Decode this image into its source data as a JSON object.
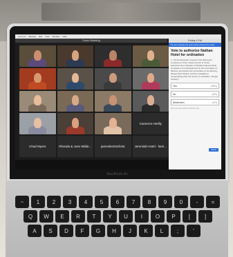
{
  "zoom": {
    "window_title": "Zoom Meeting",
    "menu": [
      "zoom.us",
      "Meeting",
      "Edit",
      "View",
      "Window",
      "Help"
    ],
    "participants": [
      {
        "name": "",
        "video": true,
        "skin": "#c98f6e",
        "shirt": "#5b4a7a",
        "bg": "#5a4d3a"
      },
      {
        "name": "",
        "video": true,
        "skin": "#d7a480",
        "shirt": "#2c3a52",
        "bg": "#4a3a2e"
      },
      {
        "name": "",
        "video": true,
        "skin": "#b98467",
        "shirt": "#8a2a2a",
        "bg": "#2e2e2e"
      },
      {
        "name": "",
        "video": true,
        "skin": "#e0b08f",
        "shirt": "#4b5b3a",
        "bg": "#6b5a44"
      },
      {
        "name": "",
        "video": true,
        "skin": "#d9996f",
        "shirt": "#c04a22",
        "bg": "#a33b1f"
      },
      {
        "name": "",
        "video": true,
        "skin": "#e3b796",
        "shirt": "#2e4a6a",
        "bg": "#5a5148"
      },
      {
        "name": "",
        "video": true,
        "skin": "#cc9a7c",
        "shirt": "#3a3a3a",
        "bg": "#4a4a4a"
      },
      {
        "name": "",
        "video": true,
        "skin": "#e2a88a",
        "shirt": "#b03a5a",
        "bg": "#6b6b6b"
      },
      {
        "name": "",
        "video": true,
        "skin": "#e8bd9c",
        "shirt": "#7a6a5a",
        "bg": "#9a8a78"
      },
      {
        "name": "",
        "video": true,
        "skin": "#d8a988",
        "shirt": "#5a5a7a",
        "bg": "#7a6a55"
      },
      {
        "name": "",
        "video": true,
        "skin": "#c99475",
        "shirt": "#3a4a5a",
        "bg": "#8a7a66"
      },
      {
        "name": "",
        "video": true,
        "skin": "#dcae90",
        "shirt": "#2a2a2a",
        "bg": "#5a5a5a"
      },
      {
        "name": "",
        "video": true,
        "skin": "#e6c0a2",
        "shirt": "#8a8aa0",
        "bg": "#9aa0a6"
      },
      {
        "name": "",
        "video": true,
        "skin": "#dca07f",
        "shirt": "#9a3a2a",
        "bg": "#4a4038"
      },
      {
        "name": "",
        "video": true,
        "skin": "#e4b292",
        "shirt": "#e2c4a8",
        "bg": "#7a6a5a"
      },
      {
        "name": "Cameron Herlily",
        "video": false
      },
      {
        "name": "Chad Myers",
        "video": false
      },
      {
        "name": "Rhonda & Jose Wilde...",
        "video": false
      },
      {
        "name": "jameslemistchrist",
        "video": false
      },
      {
        "name": "Jeremiah Hotel - fami...",
        "video": false
      }
    ]
  },
  "poll": {
    "header": "Polling 4 Poll",
    "banner": "You are viewing the poll results (Closed by host)",
    "question_title": "Vote to authorize Nathan Hotel for ordination",
    "question_body": "1. The Presbyterian Council of the Wisconsin Conference of the United Church of Christ authorizes the ordination of Nathan Hotel pending completion of a call approved by the Committee on Ministry, and directs the Committee on the Ministry, Please WCC Board, and the candidate to cooperatively plan the service of ordination. (Single Choice) *",
    "options": [
      {
        "label": "Yes",
        "percent": "(98%)"
      },
      {
        "label": "No",
        "percent": "(0%)"
      },
      {
        "label": "Abstention",
        "percent": "(2%)"
      }
    ],
    "hint": "No one has voted on Zoom yet",
    "done_label": "Done"
  },
  "laptop": {
    "brand": "MacBook Air"
  },
  "keyboard": {
    "rows": [
      [
        "~",
        "1",
        "2",
        "3",
        "4",
        "5",
        "6",
        "7",
        "8",
        "9",
        "0",
        "-",
        "="
      ],
      [
        "Q",
        "W",
        "E",
        "R",
        "T",
        "Y",
        "U",
        "I",
        "O",
        "P",
        "[",
        "]"
      ],
      [
        "A",
        "S",
        "D",
        "F",
        "G",
        "H",
        "J",
        "K",
        "L",
        ";",
        "'"
      ]
    ]
  },
  "colors": {
    "poll_accent": "#2f6fd6",
    "screen_bg": "#1c1c1c"
  }
}
